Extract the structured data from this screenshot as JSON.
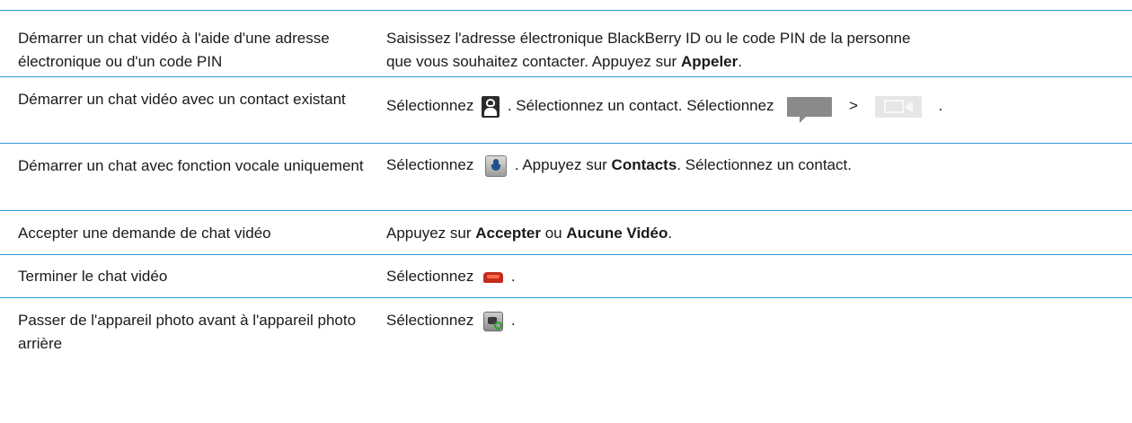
{
  "rows": [
    {
      "action": "Démarrer un chat vidéo à l'aide d'une adresse électronique ou d'un code PIN",
      "desc_line1": "Saisissez l'adresse électronique BlackBerry ID ou le code PIN de la personne",
      "desc_line2_pre": "que vous souhaitez contacter. Appuyez sur ",
      "desc_line2_bold": "Appeler",
      "desc_line2_post": "."
    },
    {
      "action": "Démarrer un chat vidéo avec un contact existant",
      "select1": "Sélectionnez",
      "mid": ". Sélectionnez un contact. Sélectionnez",
      "gt": ">",
      "end": ".",
      "icons": [
        "contacts-icon",
        "chat-bubble-icon",
        "video-camera-icon"
      ]
    },
    {
      "action": "Démarrer un chat avec fonction vocale uniquement",
      "select1": "Sélectionnez",
      "mid": ". Appuyez sur ",
      "bold": "Contacts",
      "post": ". Sélectionnez un contact.",
      "icons": [
        "microphone-icon"
      ]
    },
    {
      "action": "Accepter une demande de chat vidéo",
      "pre": "Appuyez sur ",
      "bold1": "Accepter",
      "mid": " ou ",
      "bold2": "Aucune Vidéo",
      "post": "."
    },
    {
      "action": "Terminer le chat vidéo",
      "select1": "Sélectionnez",
      "end": ".",
      "icons": [
        "hang-up-icon"
      ]
    },
    {
      "action": "Passer de l'appareil photo avant à l'appareil photo arrière",
      "select1": "Sélectionnez",
      "end": ".",
      "icons": [
        "switch-camera-icon"
      ]
    }
  ],
  "colors": {
    "divider": "#2f9bd6",
    "text": "#1a1a1a",
    "hangup": "#c42b1c",
    "mic": "#1c4f8a"
  }
}
